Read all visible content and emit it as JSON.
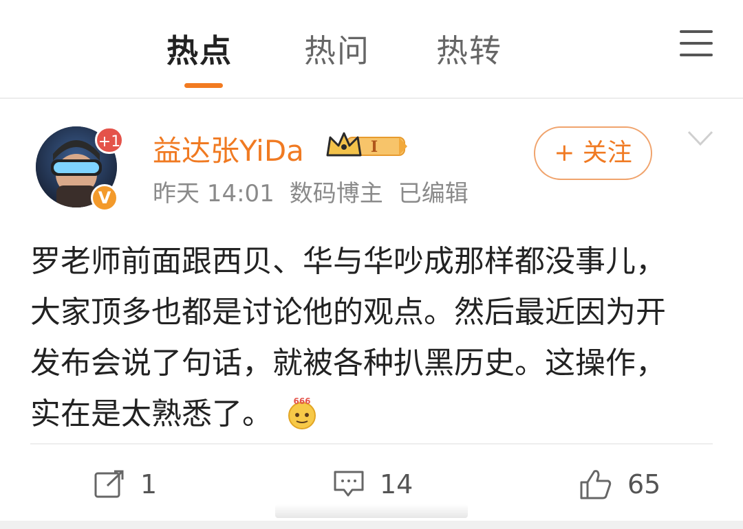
{
  "tabs": [
    {
      "label": "热点",
      "active": true
    },
    {
      "label": "热问",
      "active": false
    },
    {
      "label": "热转",
      "active": false
    }
  ],
  "menu_icon": "menu-icon",
  "post": {
    "author": "益达张YiDa",
    "badge_notification": "+1",
    "verified_badge": "V",
    "crown_level": "I",
    "time": "昨天 14:01",
    "category": "数码博主",
    "edited": "已编辑",
    "follow_label": "+ 关注",
    "text": "罗老师前面跟西贝、华与华吵成那样都没事儿，大家顶多也都是讨论他的观点。然后最近因为开发布会说了句话，就被各种扒黑历史。这操作，实在是太熟悉了。",
    "emoji_label": "666"
  },
  "actions": {
    "share_count": "1",
    "comment_count": "14",
    "like_count": "65"
  },
  "colors": {
    "accent": "#f07a22",
    "text": "#222222",
    "muted": "#8a8a8a"
  }
}
